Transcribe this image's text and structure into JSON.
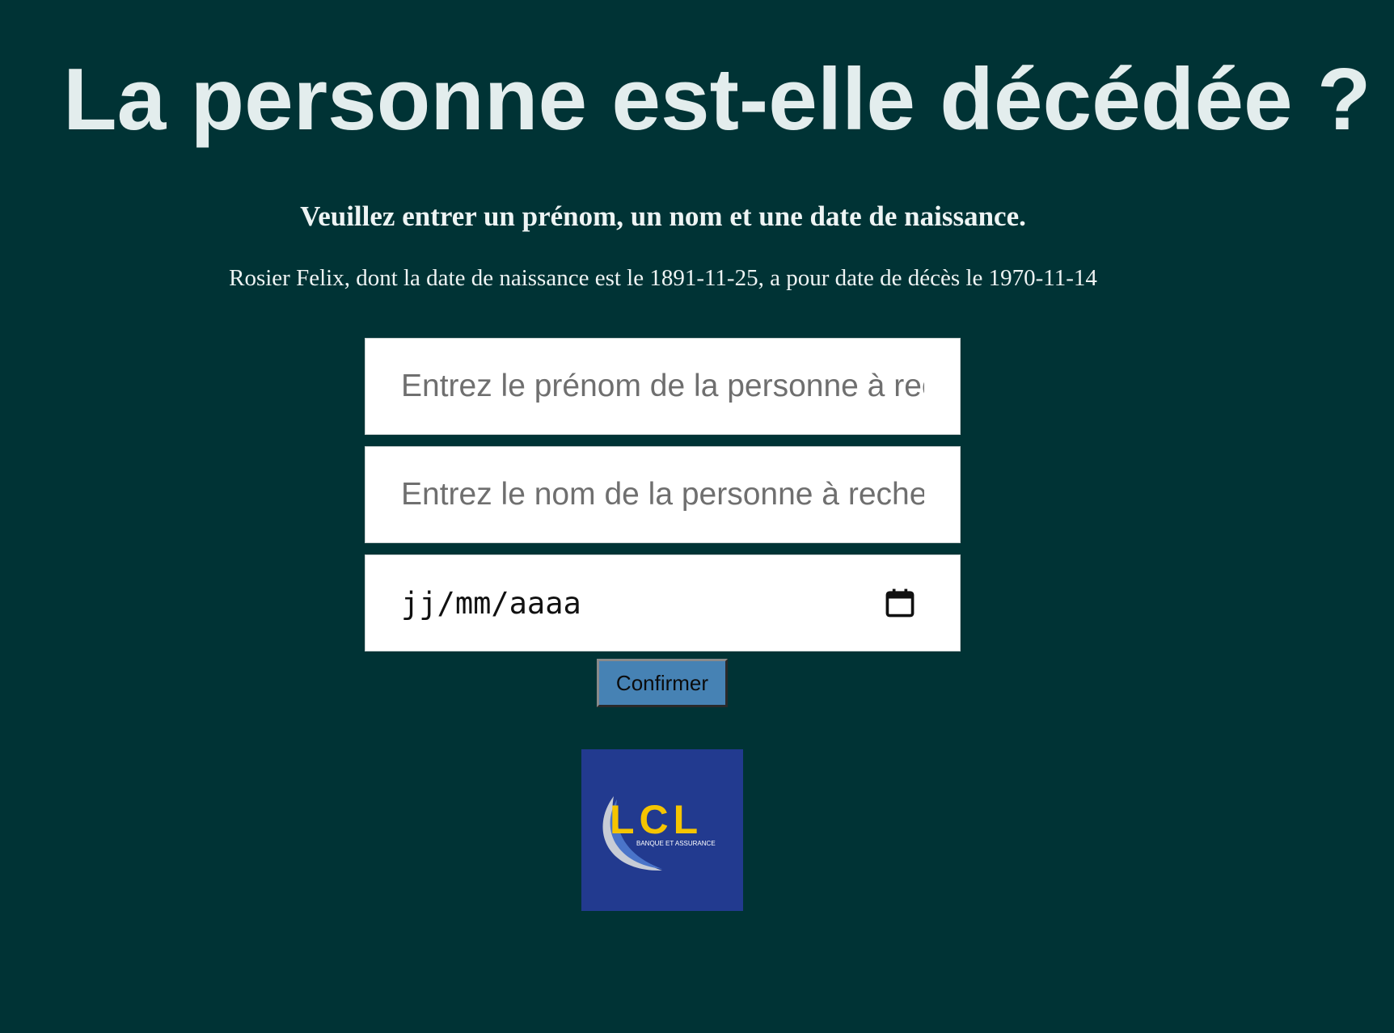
{
  "page": {
    "title": "La personne est-elle décédée ?",
    "instructions": "Veuillez entrer un prénom, un nom et une date de naissance.",
    "result_message": "Rosier Felix, dont la date de naissance est le 1891-11-25, a pour date de décès le 1970-11-14"
  },
  "form": {
    "first_name": {
      "value": "",
      "placeholder": "Entrez le prénom de la personne à rechercher"
    },
    "last_name": {
      "value": "",
      "placeholder": "Entrez le nom de la personne à rechercher"
    },
    "birth_date": {
      "value": "",
      "placeholder": "jj/mm/aaaa",
      "icon": "calendar-icon"
    },
    "submit_label": "Confirmer"
  },
  "logo": {
    "name": "LCL",
    "tagline": "BANQUE ET ASSURANCE",
    "colors": {
      "background": "#223a8f",
      "letters": "#f5c400",
      "swoosh": "#c7ccd6"
    }
  },
  "colors": {
    "background": "#003335",
    "heading_text": "#e3eded",
    "button": "#4682b4"
  }
}
